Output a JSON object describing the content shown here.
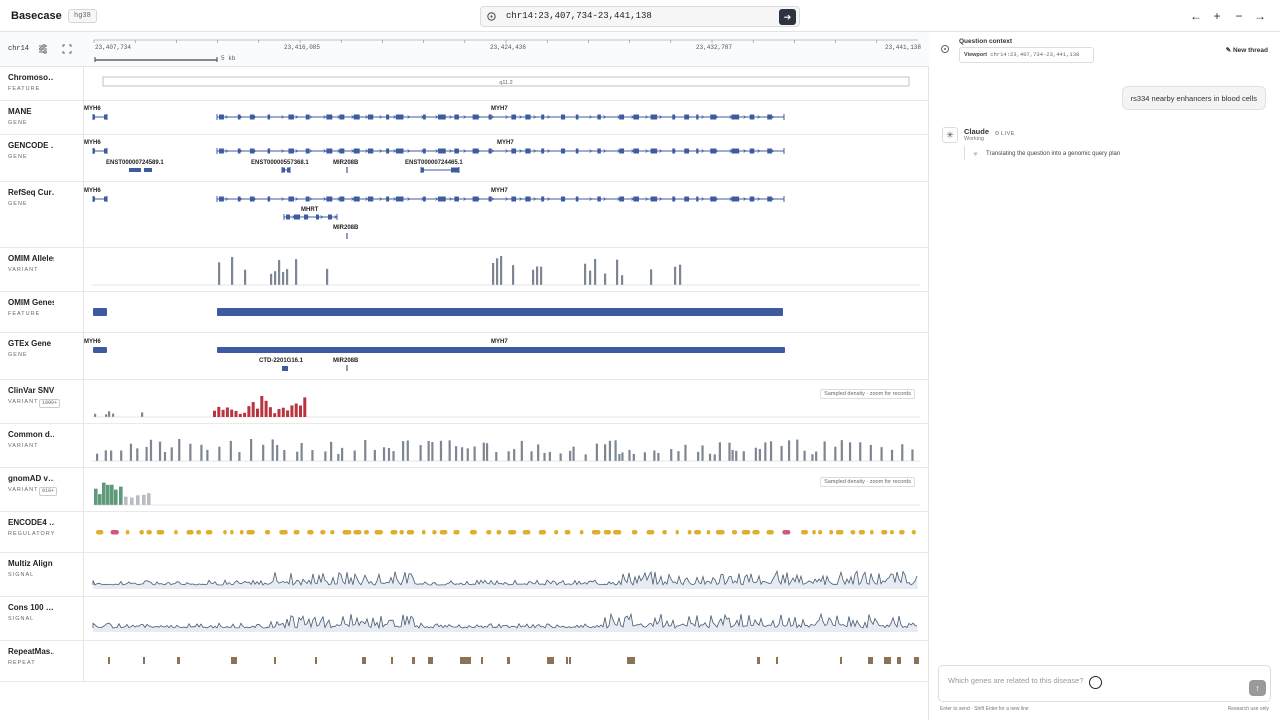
{
  "app": {
    "brand": "Basecase",
    "build": "hg38"
  },
  "search": {
    "locus": "chr14:23,407,734-23,441,138",
    "go_icon": "arrow-right-icon"
  },
  "nav": {
    "back": "←",
    "zoom_in": "+",
    "zoom_out": "−",
    "forward": "→"
  },
  "ruler": {
    "chrom": "chr14",
    "ticks": [
      "23,407,734",
      "23,416,085",
      "23,424,436",
      "23,432,787",
      "23,441,138"
    ],
    "scale": "5 kb"
  },
  "tracks": [
    {
      "name": "Chromoso…",
      "type": "FEATURE"
    },
    {
      "name": "MANE",
      "type": "GENE"
    },
    {
      "name": "GENCODE …",
      "type": "GENE"
    },
    {
      "name": "RefSeq Cur…",
      "type": "GENE"
    },
    {
      "name": "OMIM Alleles",
      "type": "VARIANT"
    },
    {
      "name": "OMIM Genes",
      "type": "FEATURE"
    },
    {
      "name": "GTEx Gene …",
      "type": "GENE"
    },
    {
      "name": "ClinVar SNVs",
      "type": "VARIANT",
      "badge": "1000+"
    },
    {
      "name": "Common d…",
      "type": "VARIANT"
    },
    {
      "name": "gnomAD v…",
      "type": "VARIANT",
      "badge": "910+"
    },
    {
      "name": "ENCODE4 …",
      "type": "REGULATORY"
    },
    {
      "name": "Multiz Align",
      "type": "SIGNAL"
    },
    {
      "name": "Cons 100 …",
      "type": "SIGNAL"
    },
    {
      "name": "RepeatMas…",
      "type": "REPEAT"
    }
  ],
  "features": {
    "band": "q11.2",
    "mane": [
      "MYH6",
      "MYH7"
    ],
    "gencode": [
      "MYH6",
      "MYH7",
      "ENST00000724589.1",
      "ENST00000557368.1",
      "MIR208B",
      "ENST00000724465.1"
    ],
    "refseq": [
      "MYH6",
      "MYH7",
      "MHRT",
      "MIR208B"
    ],
    "gtex": [
      "MYH6",
      "MYH7",
      "CTD-2201G16.1",
      "MIR208B"
    ],
    "sampled_note": "Sampled density · zoom for records"
  },
  "colors": {
    "gene": "#3e5ba0",
    "variant": "#7d8794",
    "clinvar": "#b8343f",
    "gnomad": "#5e9a7a",
    "encode_yellow": "#e0ad2c",
    "encode_pink": "#d2577f",
    "repeat": "#8c7257",
    "signal": "#455a70"
  },
  "panel": {
    "context_title": "Question context",
    "viewport_label": "Viewport",
    "viewport_value": "chr14:23,407,734-23,441,138",
    "new_thread": "New thread",
    "user_message": "rs334 nearby enhancers in blood cells",
    "agent_name": "Claude",
    "agent_status": "Working",
    "live": "LIVE",
    "step": "Translating the question into a genomic query plan",
    "composer_placeholder": "Which genes are related to this disease?",
    "hint": "Enter to send · Shift Enter for a new line",
    "research": "Research use only"
  }
}
